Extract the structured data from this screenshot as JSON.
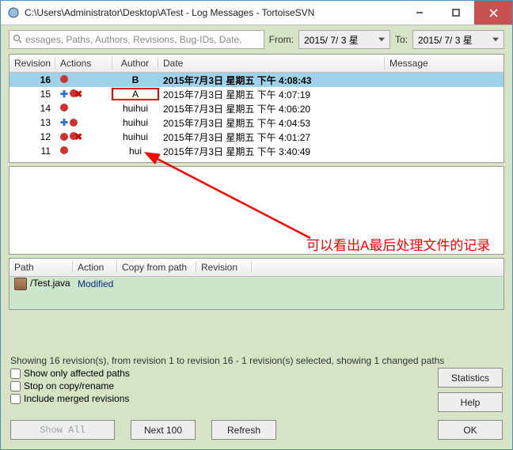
{
  "window": {
    "title": "C:\\Users\\Administrator\\Desktop\\ATest - Log Messages - TortoiseSVN"
  },
  "toolbar": {
    "search_placeholder": "essages, Paths, Authors, Revisions, Bug-IDs, Date,",
    "from_label": "From:",
    "to_label": "To:",
    "from_value": "2015/ 7/ 3 星",
    "to_value": "2015/ 7/ 3 星"
  },
  "log_columns": {
    "revision": "Revision",
    "actions": "Actions",
    "author": "Author",
    "date": "Date",
    "message": "Message"
  },
  "log_rows": [
    {
      "rev": "16",
      "author": "B",
      "date": "2015年7月3日 星期五 下午 4:08:43",
      "selected": true,
      "icons": [
        "mod"
      ]
    },
    {
      "rev": "15",
      "author": "A",
      "date": "2015年7月3日 星期五 下午 4:07:19",
      "icons": [
        "add",
        "modx"
      ],
      "mark_author": true
    },
    {
      "rev": "14",
      "author": "huihui",
      "date": "2015年7月3日 星期五 下午 4:06:20",
      "icons": [
        "mod"
      ]
    },
    {
      "rev": "13",
      "author": "huihui",
      "date": "2015年7月3日 星期五 下午 4:04:53",
      "icons": [
        "add",
        "mod"
      ]
    },
    {
      "rev": "12",
      "author": "huihui",
      "date": "2015年7月3日 星期五 下午 4:01:27",
      "icons": [
        "mod",
        "modx"
      ]
    },
    {
      "rev": "11",
      "author": "hui",
      "date": "2015年7月3日 星期五 下午 3:40:49",
      "icons": [
        "mod"
      ]
    }
  ],
  "annotation": {
    "text": "可以看出A最后处理文件的记录"
  },
  "files_columns": {
    "path": "Path",
    "action": "Action",
    "copy": "Copy from path",
    "revision": "Revision"
  },
  "file_rows": [
    {
      "path": "/Test.java",
      "action": "Modified"
    }
  ],
  "status_line": "Showing 16 revision(s), from revision 1 to revision 16 - 1 revision(s) selected, showing 1 changed paths",
  "checkboxes": {
    "affected": "Show only affected paths",
    "stop": "Stop on copy/rename",
    "merged": "Include merged revisions"
  },
  "buttons": {
    "statistics": "Statistics",
    "help": "Help",
    "show_all": "Show All",
    "next100": "Next 100",
    "refresh": "Refresh",
    "ok": "OK"
  }
}
